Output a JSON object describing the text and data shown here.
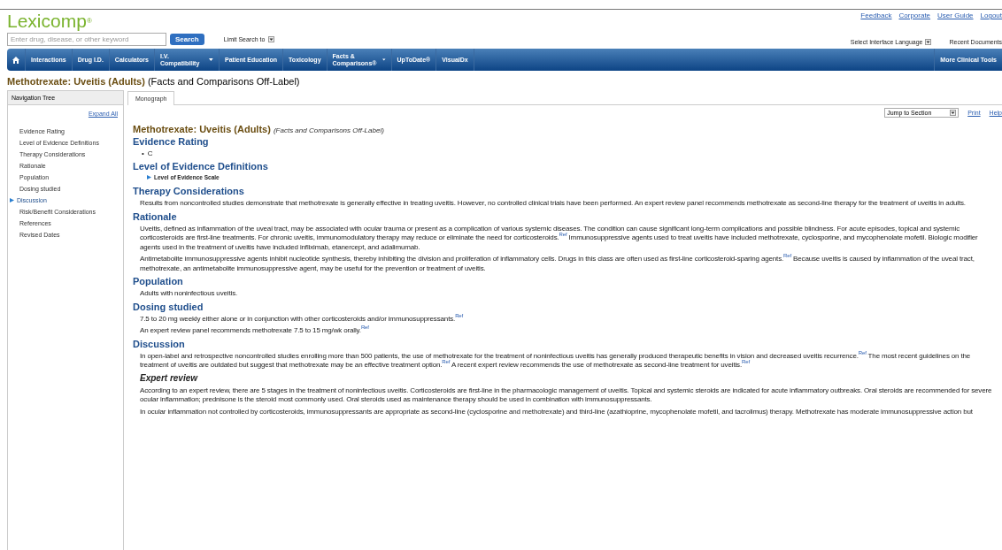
{
  "header": {
    "logo": "Lexicomp",
    "logo_mark": "®",
    "search": {
      "placeholder": "Enter drug, disease, or other keyword",
      "button": "Search"
    },
    "limit_search": "Limit Search to",
    "links": [
      "Feedback",
      "Corporate",
      "User Guide",
      "Logout"
    ],
    "language": "Select Interface Language",
    "recent": "Recent Documents"
  },
  "nav": {
    "items": [
      {
        "label": "Interactions",
        "dropdown": false
      },
      {
        "label": "Drug I.D.",
        "dropdown": false
      },
      {
        "label": "Calculators",
        "dropdown": false
      },
      {
        "label": "I.V. Compatibility",
        "dropdown": true
      },
      {
        "label": "Patient Education",
        "dropdown": false
      },
      {
        "label": "Toxicology",
        "dropdown": false
      },
      {
        "label": "Facts & Comparisons®",
        "dropdown": true
      },
      {
        "label": "UpToDate®",
        "dropdown": false
      },
      {
        "label": "VisualDx",
        "dropdown": false
      }
    ],
    "right": "More Clinical Tools"
  },
  "page_title": {
    "main": "Methotrexate: Uveitis (Adults)",
    "sub": "(Facts and Comparisons Off-Label)"
  },
  "sidebar": {
    "title": "Navigation Tree",
    "expand_all": "Expand All",
    "items": [
      {
        "label": "Evidence Rating",
        "selected": false
      },
      {
        "label": "Level of Evidence Definitions",
        "selected": false
      },
      {
        "label": "Therapy Considerations",
        "selected": false
      },
      {
        "label": "Rationale",
        "selected": false
      },
      {
        "label": "Population",
        "selected": false
      },
      {
        "label": "Dosing studied",
        "selected": false
      },
      {
        "label": "Discussion",
        "selected": true
      },
      {
        "label": "Risk/Benefit Considerations",
        "selected": false
      },
      {
        "label": "References",
        "selected": false
      },
      {
        "label": "Revised Dates",
        "selected": false
      }
    ]
  },
  "tabs": [
    {
      "label": "Monograph",
      "selected": true
    }
  ],
  "toolbar": {
    "jump": "Jump to Section",
    "print": "Print",
    "help": "Help"
  },
  "monograph": {
    "title": "Methotrexate: Uveitis (Adults)",
    "subtitle": "(Facts and Comparisons Off-Label)",
    "sections": [
      {
        "heading": "Evidence Rating",
        "blocks": [
          {
            "kind": "bullet",
            "marker": "•",
            "text": "C"
          }
        ]
      },
      {
        "heading": "Level of Evidence Definitions",
        "blocks": [
          {
            "kind": "expander",
            "text": "Level of Evidence Scale"
          }
        ]
      },
      {
        "heading": "Therapy Considerations",
        "blocks": [
          {
            "kind": "paragraph",
            "text": "Results from noncontrolled studies demonstrate that methotrexate is generally effective in treating uveitis. However, no controlled clinical trials have been performed. An expert review panel recommends methotrexate as second-line therapy for the treatment of uveitis in adults."
          }
        ]
      },
      {
        "heading": "Rationale",
        "blocks": [
          {
            "kind": "paragraph",
            "text": "Uveitis, defined as inflammation of the uveal tract, may be associated with ocular trauma or present as a complication of various systemic diseases. The condition can cause significant long-term complications and possible blindness. For acute episodes, topical and systemic corticosteroids are first-line treatments. For chronic uveitis, immunomodulatory therapy may reduce or eliminate the need for corticosteroids.$^{Ref}$ Immunosuppressive agents used to treat uveitis have included methotrexate, cyclosporine, and mycophenolate mofetil. Biologic modifier agents used in the treatment of uveitis have included infliximab, etanercept, and adalimumab."
          },
          {
            "kind": "paragraph",
            "text": "Antimetabolite immunosuppressive agents inhibit nucleotide synthesis, thereby inhibiting the division and proliferation of inflammatory cells. Drugs in this class are often used as first-line corticosteroid-sparing agents.$^{Ref}$ Because uveitis is caused by inflammation of the uveal tract, methotrexate, an antimetabolite immunosuppressive agent, may be useful for the prevention or treatment of uveitis."
          }
        ]
      },
      {
        "heading": "Population",
        "blocks": [
          {
            "kind": "paragraph",
            "text": "Adults with noninfectious uveitis."
          }
        ]
      },
      {
        "heading": "Dosing studied",
        "blocks": [
          {
            "kind": "paragraph",
            "text": "7.5 to 20 mg weekly either alone or in conjunction with other corticosteroids and/or immunosuppressants.$^{Ref}$"
          },
          {
            "kind": "paragraph",
            "text": "An expert review panel recommends methotrexate 7.5 to 15 mg/wk orally.$^{Ref}$"
          }
        ]
      },
      {
        "heading": "Discussion",
        "blocks": [
          {
            "kind": "paragraph",
            "text": "In open-label and retrospective noncontrolled studies enrolling more than 500 patients, the use of methotrexate for the treatment of noninfectious uveitis has generally produced therapeutic benefits in vision and decreased uveitis recurrence.$^{Ref}$ The most recent guidelines on the treatment of uveitis are outdated but suggest that methotrexate may be an effective treatment option.$^{Ref}$ A recent expert review recommends the use of methotrexate as second-line treatment for uveitis.$^{Ref}$"
          },
          {
            "kind": "subheading",
            "text": "Expert review"
          },
          {
            "kind": "paragraph",
            "text": "According to an expert review, there are 5 stages in the treatment of noninfectious uveitis. Corticosteroids are first-line in the pharmacologic management of uveitis. Topical and systemic steroids are indicated for acute inflammatory outbreaks. Oral steroids are recommended for severe ocular inflammation; prednisone is the steroid most commonly used. Oral steroids used as maintenance therapy should be used in combination with immunosuppressants."
          },
          {
            "kind": "paragraph",
            "text": "In ocular inflammation not controlled by corticosteroids, immunosuppressants are appropriate as second-line (cyclosporine and methotrexate) and third-line (azathioprine, mycophenolate mofetil, and tacrolimus) therapy. Methotrexate has moderate immunosuppressive action but"
          }
        ]
      }
    ]
  }
}
